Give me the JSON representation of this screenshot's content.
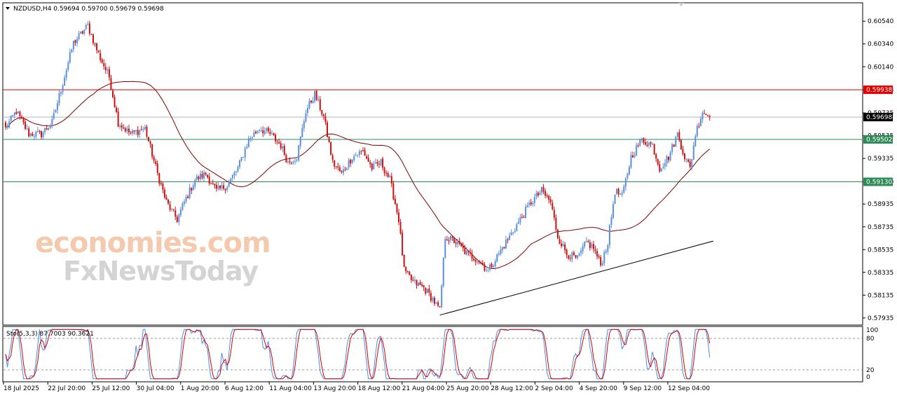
{
  "chart_data": {
    "type": "candlestick",
    "symbol_header": "NZDUSD,H4  0.59694 0.59700 0.59679 0.59698",
    "y_ticks": [
      0.6054,
      0.6034,
      0.6014,
      0.59938,
      0.59735,
      0.59535,
      0.59335,
      0.5913,
      0.58935,
      0.58735,
      0.58535,
      0.58335,
      0.58135,
      0.57935
    ],
    "y_tick_labels": [
      "0.60540",
      "0.60340",
      "0.60140",
      "0.59938",
      "0.59735",
      "0.59698",
      "0.59535",
      "0.59502",
      "0.59335",
      "0.59130",
      "0.58935",
      "0.58735",
      "0.58535",
      "0.58335",
      "0.58135",
      "0.57935"
    ],
    "ylim": [
      0.57885,
      0.60695
    ],
    "x_labels": [
      "18 Jul 2025",
      "22 Jul 20:00",
      "25 Jul 12:00",
      "30 Jul 04:00",
      "1 Aug 20:00",
      "6 Aug 12:00",
      "11 Aug 04:00",
      "13 Aug 20:00",
      "18 Aug 12:00",
      "21 Aug 04:00",
      "25 Aug 20:00",
      "28 Aug 12:00",
      "2 Sep 04:00",
      "4 Sep 20:00",
      "9 Sep 12:00",
      "12 Sep 04:00"
    ],
    "close_anchors": [
      [
        0,
        0.596
      ],
      [
        6,
        0.5975
      ],
      [
        13,
        0.5955
      ],
      [
        20,
        0.5955
      ],
      [
        26,
        0.5965
      ],
      [
        32,
        0.6
      ],
      [
        38,
        0.6035
      ],
      [
        46,
        0.605
      ],
      [
        52,
        0.6025
      ],
      [
        58,
        0.6005
      ],
      [
        63,
        0.5965
      ],
      [
        70,
        0.5955
      ],
      [
        78,
        0.596
      ],
      [
        85,
        0.592
      ],
      [
        90,
        0.5895
      ],
      [
        96,
        0.588
      ],
      [
        100,
        0.5895
      ],
      [
        106,
        0.5915
      ],
      [
        112,
        0.592
      ],
      [
        118,
        0.5905
      ],
      [
        124,
        0.591
      ],
      [
        130,
        0.5925
      ],
      [
        136,
        0.595
      ],
      [
        142,
        0.596
      ],
      [
        148,
        0.5955
      ],
      [
        154,
        0.5945
      ],
      [
        158,
        0.593
      ],
      [
        163,
        0.5935
      ],
      [
        168,
        0.5975
      ],
      [
        173,
        0.599
      ],
      [
        178,
        0.597
      ],
      [
        183,
        0.593
      ],
      [
        188,
        0.592
      ],
      [
        194,
        0.5935
      ],
      [
        200,
        0.594
      ],
      [
        205,
        0.5925
      ],
      [
        210,
        0.593
      ],
      [
        215,
        0.5915
      ],
      [
        220,
        0.588
      ],
      [
        223,
        0.5835
      ],
      [
        228,
        0.5825
      ],
      [
        234,
        0.582
      ],
      [
        239,
        0.581
      ],
      [
        243,
        0.58
      ],
      [
        246,
        0.5865
      ],
      [
        252,
        0.586
      ],
      [
        258,
        0.585
      ],
      [
        264,
        0.5845
      ],
      [
        270,
        0.5835
      ],
      [
        276,
        0.585
      ],
      [
        282,
        0.5865
      ],
      [
        288,
        0.588
      ],
      [
        294,
        0.5895
      ],
      [
        300,
        0.5905
      ],
      [
        305,
        0.5895
      ],
      [
        309,
        0.5865
      ],
      [
        314,
        0.585
      ],
      [
        320,
        0.5845
      ],
      [
        325,
        0.586
      ],
      [
        329,
        0.5855
      ],
      [
        333,
        0.584
      ],
      [
        337,
        0.586
      ],
      [
        341,
        0.5905
      ],
      [
        345,
        0.59
      ],
      [
        350,
        0.5935
      ],
      [
        356,
        0.595
      ],
      [
        362,
        0.5945
      ],
      [
        366,
        0.5925
      ],
      [
        371,
        0.5935
      ],
      [
        376,
        0.5955
      ],
      [
        380,
        0.5935
      ],
      [
        383,
        0.5925
      ],
      [
        386,
        0.5955
      ],
      [
        390,
        0.5975
      ],
      [
        394,
        0.597
      ]
    ],
    "volatility": 0.00045,
    "levels": [
      {
        "value": 0.59938,
        "label": "0.59938",
        "color": "#e00000"
      },
      {
        "value": 0.59502,
        "label": "0.59502",
        "color": "#2e8b57"
      },
      {
        "value": 0.5913,
        "label": "0.59130",
        "color": "#2e8b57"
      }
    ],
    "current_price": {
      "value": 0.59698,
      "label": "0.59698"
    },
    "trendline": {
      "from": [
        243,
        0.5796
      ],
      "to": [
        396,
        0.5861
      ]
    },
    "moving_average": {
      "period": 50,
      "color": "#800000"
    },
    "stochastic": {
      "label": "Sto(5,3,3) 87.7003 90.3621",
      "levels": [
        100,
        80,
        20,
        0
      ],
      "level_labels": [
        "100",
        "80",
        "20",
        "0"
      ],
      "main_color": "#4d8ce6",
      "signal_color": "#d00000"
    },
    "colors": {
      "bull": "#5b8fdb",
      "bear": "#d01010",
      "bg": "#ffffff",
      "frame": "#000000"
    }
  },
  "watermark": {
    "line1": "economies.com",
    "line2": "FxNewsToday"
  }
}
